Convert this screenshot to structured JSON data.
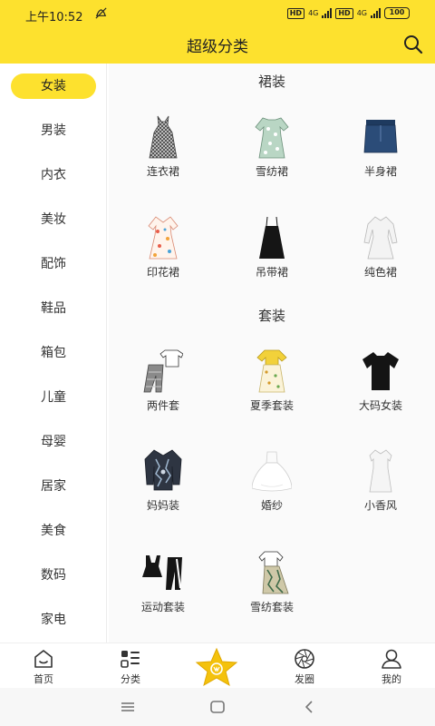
{
  "status_bar": {
    "time": "上午10:52",
    "hd1": "HD",
    "net1": "4G",
    "hd2": "HD",
    "net2": "4G",
    "battery": "100"
  },
  "header": {
    "title": "超级分类",
    "search_icon": "search-icon",
    "accent_color": "#fde12e"
  },
  "sidebar": {
    "items": [
      {
        "label": "女装",
        "active": true
      },
      {
        "label": "男装"
      },
      {
        "label": "内衣"
      },
      {
        "label": "美妆"
      },
      {
        "label": "配饰"
      },
      {
        "label": "鞋品"
      },
      {
        "label": "箱包"
      },
      {
        "label": "儿童"
      },
      {
        "label": "母婴"
      },
      {
        "label": "居家"
      },
      {
        "label": "美食"
      },
      {
        "label": "数码"
      },
      {
        "label": "家电"
      }
    ]
  },
  "sections": [
    {
      "title": "裙装",
      "items": [
        {
          "label": "连衣裙",
          "icon": "checked-dress-icon"
        },
        {
          "label": "雪纺裙",
          "icon": "floral-dress-icon"
        },
        {
          "label": "半身裙",
          "icon": "denim-skirt-icon"
        },
        {
          "label": "印花裙",
          "icon": "print-dress-icon"
        },
        {
          "label": "吊带裙",
          "icon": "slip-dress-icon"
        },
        {
          "label": "纯色裙",
          "icon": "white-dress-icon"
        }
      ]
    },
    {
      "title": "套装",
      "items": [
        {
          "label": "两件套",
          "icon": "two-piece-icon"
        },
        {
          "label": "夏季套装",
          "icon": "summer-set-icon"
        },
        {
          "label": "大码女装",
          "icon": "black-tee-icon"
        },
        {
          "label": "妈妈装",
          "icon": "mom-blouse-icon"
        },
        {
          "label": "婚纱",
          "icon": "wedding-dress-icon"
        },
        {
          "label": "小香风",
          "icon": "tweed-dress-icon"
        },
        {
          "label": "运动套装",
          "icon": "sport-set-icon"
        },
        {
          "label": "雪纺套装",
          "icon": "chiffon-set-icon"
        }
      ]
    }
  ],
  "bottom_nav": {
    "items": [
      {
        "label": "首页",
        "icon": "home-icon"
      },
      {
        "label": "分类",
        "icon": "category-icon"
      },
      {
        "label": "",
        "icon": "star-icon"
      },
      {
        "label": "发圈",
        "icon": "shutter-icon"
      },
      {
        "label": "我的",
        "icon": "user-icon"
      }
    ]
  },
  "system_nav": {
    "icons": [
      "menu-icon",
      "home-square-icon",
      "back-icon"
    ]
  }
}
